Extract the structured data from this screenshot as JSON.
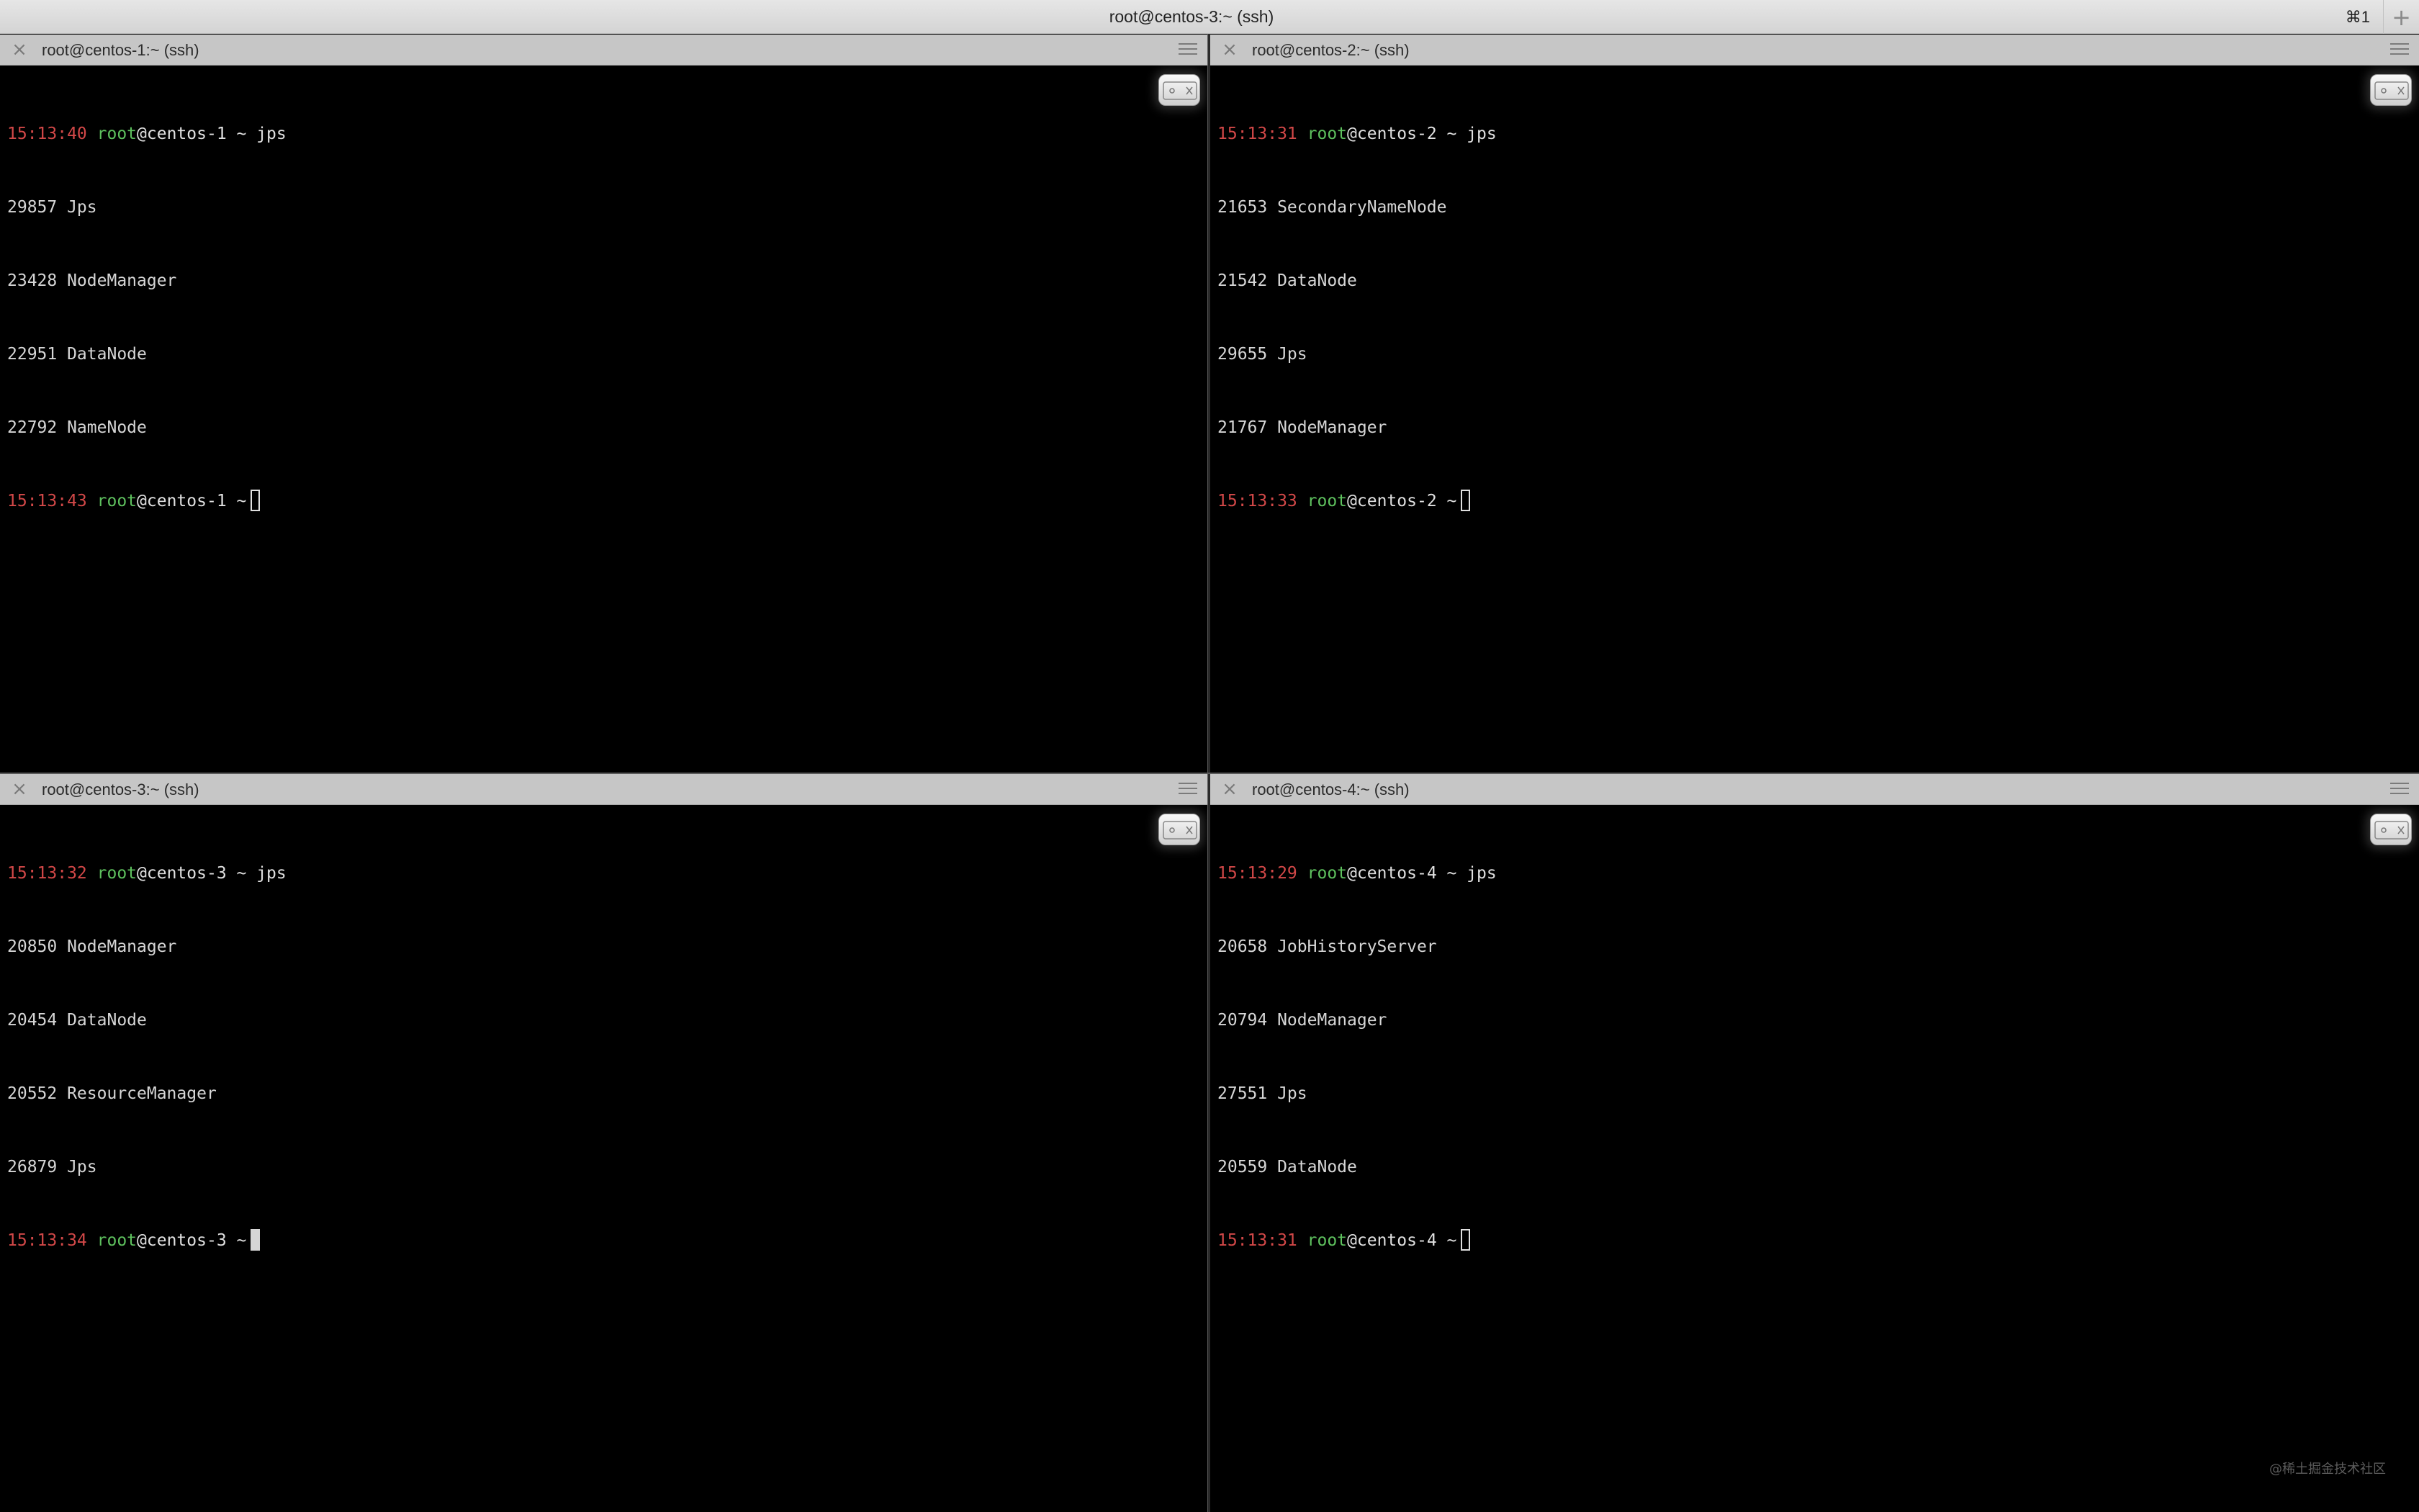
{
  "window": {
    "title": "root@centos-3:~ (ssh)",
    "shortcut": "⌘1",
    "new_tab_icon": "+"
  },
  "colors": {
    "timestamp": "#d24848",
    "user": "#5ec15e",
    "text": "#d6d6d6",
    "pane_header": "#c6c6c6",
    "background": "#000000"
  },
  "icons": {
    "close": "close-icon",
    "menu": "hamburger-menu-icon",
    "broadcast": "broadcast-input-icon"
  },
  "panes": [
    {
      "title": "root@centos-1:~ (ssh)",
      "prompt1": {
        "time": "15:13:40",
        "user": "root",
        "at": "@",
        "host": "centos-1",
        "tail": " ~ jps"
      },
      "output": [
        "29857 Jps",
        "23428 NodeManager",
        "22951 DataNode",
        "22792 NameNode"
      ],
      "prompt2": {
        "time": "15:13:43",
        "user": "root",
        "at": "@",
        "host": "centos-1",
        "tail": " ~"
      }
    },
    {
      "title": "root@centos-2:~ (ssh)",
      "prompt1": {
        "time": "15:13:31",
        "user": "root",
        "at": "@",
        "host": "centos-2",
        "tail": " ~ jps"
      },
      "output": [
        "21653 SecondaryNameNode",
        "21542 DataNode",
        "29655 Jps",
        "21767 NodeManager"
      ],
      "prompt2": {
        "time": "15:13:33",
        "user": "root",
        "at": "@",
        "host": "centos-2",
        "tail": " ~"
      }
    },
    {
      "title": "root@centos-3:~ (ssh)",
      "prompt1": {
        "time": "15:13:32",
        "user": "root",
        "at": "@",
        "host": "centos-3",
        "tail": " ~ jps"
      },
      "output": [
        "20850 NodeManager",
        "20454 DataNode",
        "20552 ResourceManager",
        "26879 Jps"
      ],
      "prompt2": {
        "time": "15:13:34",
        "user": "root",
        "at": "@",
        "host": "centos-3",
        "tail": " ~"
      }
    },
    {
      "title": "root@centos-4:~ (ssh)",
      "prompt1": {
        "time": "15:13:29",
        "user": "root",
        "at": "@",
        "host": "centos-4",
        "tail": " ~ jps"
      },
      "output": [
        "20658 JobHistoryServer",
        "20794 NodeManager",
        "27551 Jps",
        "20559 DataNode"
      ],
      "prompt2": {
        "time": "15:13:31",
        "user": "root",
        "at": "@",
        "host": "centos-4",
        "tail": " ~"
      }
    }
  ],
  "watermark": "@稀土掘金技术社区"
}
